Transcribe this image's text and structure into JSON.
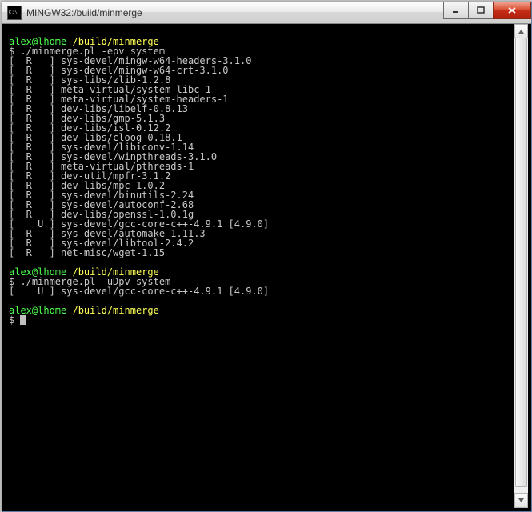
{
  "window": {
    "title": "MINGW32:/build/minmerge"
  },
  "prompt": {
    "user_host": "alex@lhome",
    "path": "/build/minmerge",
    "symbol": "$"
  },
  "session1": {
    "command": "./minmerge.pl -epv system",
    "lines": [
      {
        "flag": "R",
        "pkg": "sys-devel/mingw-w64-headers-3.1.0",
        "extra": ""
      },
      {
        "flag": "R",
        "pkg": "sys-devel/mingw-w64-crt-3.1.0",
        "extra": ""
      },
      {
        "flag": "R",
        "pkg": "sys-libs/zlib-1.2.8",
        "extra": ""
      },
      {
        "flag": "R",
        "pkg": "meta-virtual/system-libc-1",
        "extra": ""
      },
      {
        "flag": "R",
        "pkg": "meta-virtual/system-headers-1",
        "extra": ""
      },
      {
        "flag": "R",
        "pkg": "dev-libs/libelf-0.8.13",
        "extra": ""
      },
      {
        "flag": "R",
        "pkg": "dev-libs/gmp-5.1.3",
        "extra": ""
      },
      {
        "flag": "R",
        "pkg": "dev-libs/isl-0.12.2",
        "extra": ""
      },
      {
        "flag": "R",
        "pkg": "dev-libs/cloog-0.18.1",
        "extra": ""
      },
      {
        "flag": "R",
        "pkg": "sys-devel/libiconv-1.14",
        "extra": ""
      },
      {
        "flag": "R",
        "pkg": "sys-devel/winpthreads-3.1.0",
        "extra": ""
      },
      {
        "flag": "R",
        "pkg": "meta-virtual/pthreads-1",
        "extra": ""
      },
      {
        "flag": "R",
        "pkg": "dev-util/mpfr-3.1.2",
        "extra": ""
      },
      {
        "flag": "R",
        "pkg": "dev-libs/mpc-1.0.2",
        "extra": ""
      },
      {
        "flag": "R",
        "pkg": "sys-devel/binutils-2.24",
        "extra": ""
      },
      {
        "flag": "R",
        "pkg": "sys-devel/autoconf-2.68",
        "extra": ""
      },
      {
        "flag": "R",
        "pkg": "dev-libs/openssl-1.0.1g",
        "extra": ""
      },
      {
        "flag": "U",
        "pkg": "sys-devel/gcc-core-c++-4.9.1",
        "extra": "[4.9.0]"
      },
      {
        "flag": "R",
        "pkg": "sys-devel/automake-1.11.3",
        "extra": ""
      },
      {
        "flag": "R",
        "pkg": "sys-devel/libtool-2.4.2",
        "extra": ""
      },
      {
        "flag": "R",
        "pkg": "net-misc/wget-1.15",
        "extra": ""
      }
    ]
  },
  "session2": {
    "command": "./minmerge.pl -uDpv system",
    "lines": [
      {
        "flag": "U",
        "pkg": "sys-devel/gcc-core-c++-4.9.1",
        "extra": "[4.9.0]"
      }
    ]
  }
}
